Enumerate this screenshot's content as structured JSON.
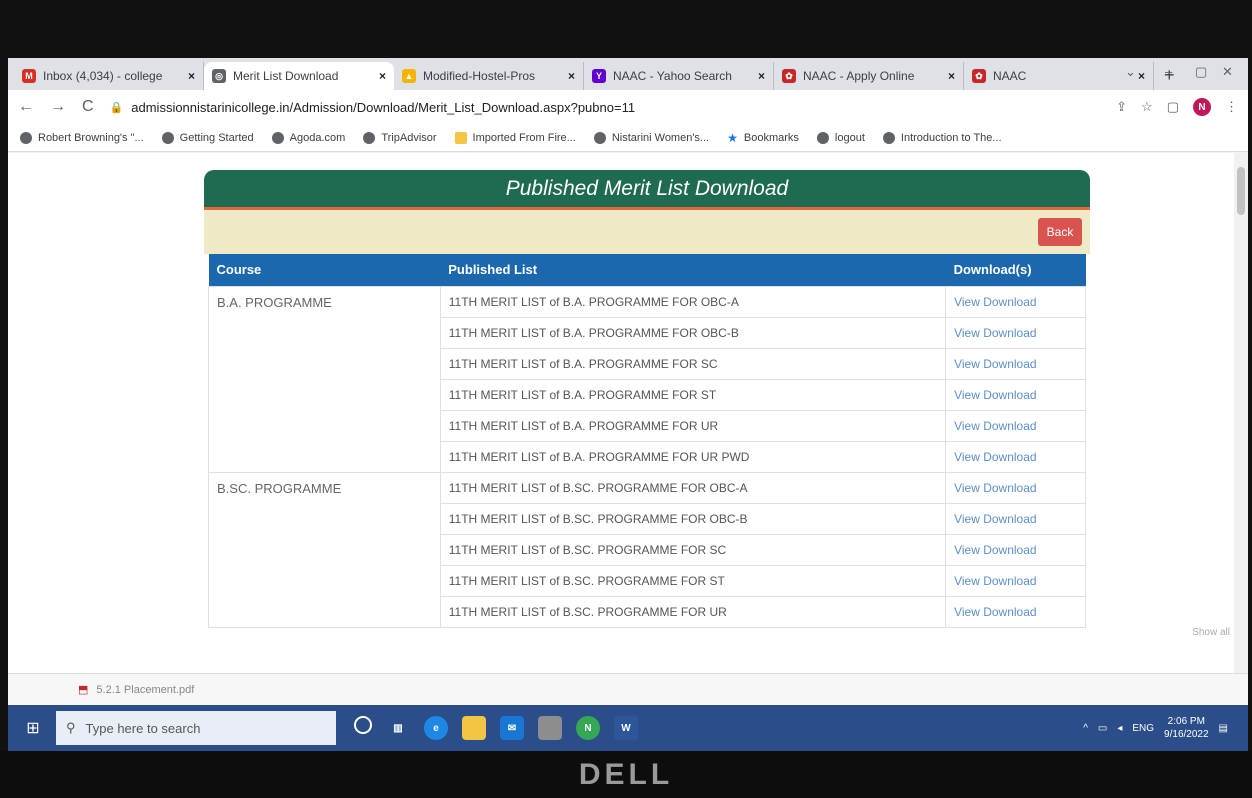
{
  "tabs": [
    {
      "label": "Inbox (4,034) - college",
      "icon": "gmail-icon",
      "color": "#d93025",
      "glyph": "M",
      "active": false
    },
    {
      "label": "Merit List Download",
      "icon": "globe-icon",
      "color": "#5f6368",
      "glyph": "◎",
      "active": true
    },
    {
      "label": "Modified-Hostel-Pros",
      "icon": "drive-icon",
      "color": "#f4b400",
      "glyph": "▲",
      "active": false
    },
    {
      "label": "NAAC - Yahoo Search",
      "icon": "yahoo-icon",
      "color": "#6001d2",
      "glyph": "Y",
      "active": false
    },
    {
      "label": "NAAC - Apply Online",
      "icon": "naac-icon",
      "color": "#c62828",
      "glyph": "✿",
      "active": false
    },
    {
      "label": "NAAC",
      "icon": "naac-icon",
      "color": "#c62828",
      "glyph": "✿",
      "active": false
    }
  ],
  "url": "admissionnistarinicollege.in/Admission/Download/Merit_List_Download.aspx?pubno=11",
  "profile_initial": "N",
  "bookmarks": [
    {
      "label": "Robert Browning's \"...",
      "kind": "globe"
    },
    {
      "label": "Getting Started",
      "kind": "globe"
    },
    {
      "label": "Agoda.com",
      "kind": "globe"
    },
    {
      "label": "TripAdvisor",
      "kind": "globe"
    },
    {
      "label": "Imported From Fire...",
      "kind": "folder"
    },
    {
      "label": "Nistarini Women's...",
      "kind": "globe"
    },
    {
      "label": "Bookmarks",
      "kind": "star"
    },
    {
      "label": "logout",
      "kind": "globe"
    },
    {
      "label": "Introduction to The...",
      "kind": "globe"
    }
  ],
  "page": {
    "title": "Published Merit List Download",
    "back_label": "Back",
    "headers": {
      "course": "Course",
      "list": "Published List",
      "download": "Download(s)"
    },
    "groups": [
      {
        "course": "B.A. PROGRAMME",
        "rows": [
          "11TH MERIT LIST of B.A. PROGRAMME FOR OBC-A",
          "11TH MERIT LIST of B.A. PROGRAMME FOR OBC-B",
          "11TH MERIT LIST of B.A. PROGRAMME FOR SC",
          "11TH MERIT LIST of B.A. PROGRAMME FOR ST",
          "11TH MERIT LIST of B.A. PROGRAMME FOR UR",
          "11TH MERIT LIST of B.A. PROGRAMME FOR UR PWD"
        ]
      },
      {
        "course": "B.SC. PROGRAMME",
        "rows": [
          "11TH MERIT LIST of B.SC. PROGRAMME FOR OBC-A",
          "11TH MERIT LIST of B.SC. PROGRAMME FOR OBC-B",
          "11TH MERIT LIST of B.SC. PROGRAMME FOR SC",
          "11TH MERIT LIST of B.SC. PROGRAMME FOR ST",
          "11TH MERIT LIST of B.SC. PROGRAMME FOR UR"
        ]
      }
    ],
    "download_label": "View Download"
  },
  "download_bar": {
    "file": "5.2.1 Placement.pdf",
    "show_all": "Show all"
  },
  "taskbar": {
    "search_placeholder": "Type here to search",
    "lang": "ENG",
    "time": "2:06 PM",
    "date": "9/16/2022"
  },
  "monitor_brand": "DELL"
}
